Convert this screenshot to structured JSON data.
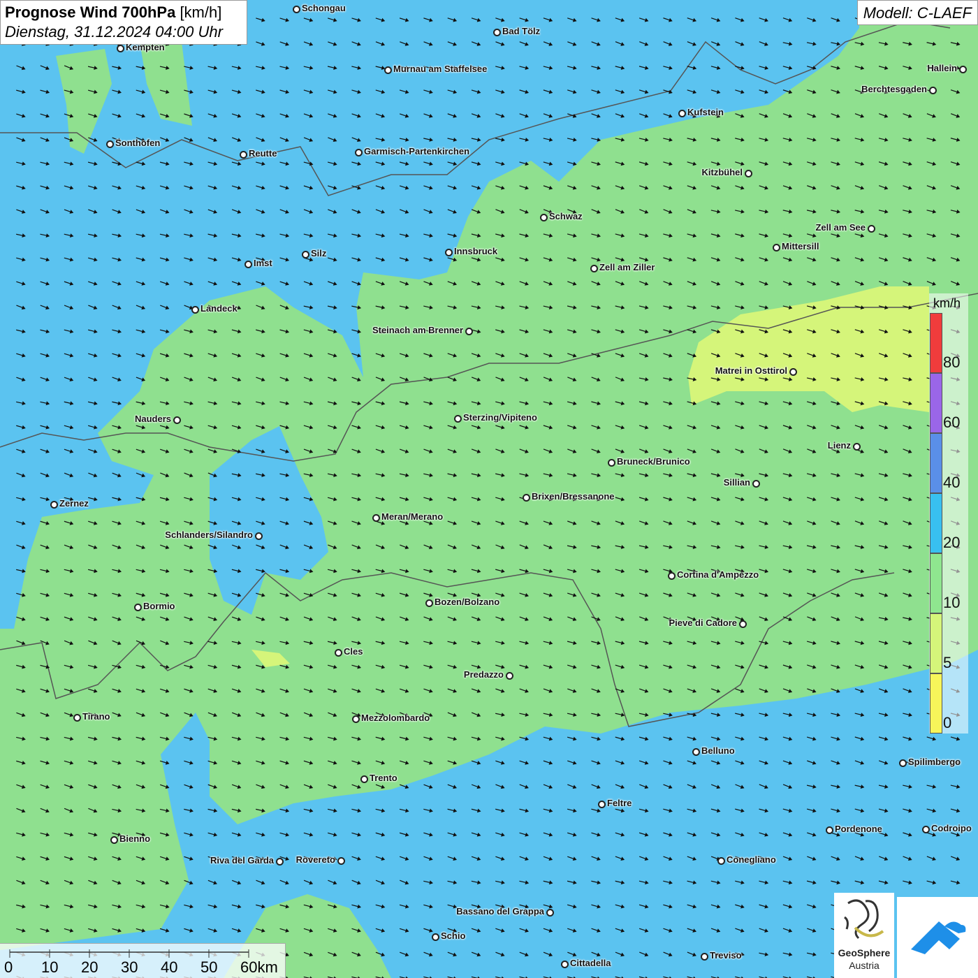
{
  "title": {
    "main": "Prognose Wind 700hPa",
    "unit": "[km/h]",
    "datetime": "Dienstag, 31.12.2024 04:00 Uhr"
  },
  "model_label": "Modell: C-LAEF",
  "colors": {
    "calm_cyan": "#5bc3f0",
    "light_green": "#8fe08f",
    "yellow_green": "#d5f57a",
    "yellow": "#f7f55a",
    "blue": "#5a8fe8",
    "purple": "#9a66e8",
    "red": "#f03c3c",
    "pale_blue": "#bfe6ff"
  },
  "legend": {
    "unit": "km/h",
    "labels": [
      "80",
      "60",
      "40",
      "20",
      "10",
      "5",
      "0"
    ],
    "bands": [
      {
        "from": 80,
        "to": 100,
        "color": "#f03c3c"
      },
      {
        "from": 60,
        "to": 80,
        "color": "#9a66e8"
      },
      {
        "from": 40,
        "to": 60,
        "color": "#5a8fe8"
      },
      {
        "from": 20,
        "to": 40,
        "color": "#38c0f0"
      },
      {
        "from": 10,
        "to": 20,
        "color": "#8fe68f"
      },
      {
        "from": 5,
        "to": 10,
        "color": "#d5f57a"
      },
      {
        "from": 0,
        "to": 5,
        "color": "#f7f55a"
      }
    ]
  },
  "scale_bar": {
    "labels": [
      "0",
      "10",
      "20",
      "30",
      "40",
      "50",
      "60km"
    ]
  },
  "cities": [
    {
      "name": "Schongau"
    },
    {
      "name": "Bad Tölz"
    },
    {
      "name": "Kempten"
    },
    {
      "name": "Murnau am Staffelsee"
    },
    {
      "name": "Hallein"
    },
    {
      "name": "Berchtesgaden"
    },
    {
      "name": "Kufstein"
    },
    {
      "name": "Sonthofen"
    },
    {
      "name": "Reutte"
    },
    {
      "name": "Garmisch-Partenkirchen"
    },
    {
      "name": "Kitzbühel"
    },
    {
      "name": "Schwaz"
    },
    {
      "name": "Zell am See"
    },
    {
      "name": "Mittersill"
    },
    {
      "name": "Innsbruck"
    },
    {
      "name": "Silz"
    },
    {
      "name": "Imst"
    },
    {
      "name": "Zell am Ziller"
    },
    {
      "name": "Landeck"
    },
    {
      "name": "Steinach am Brenner"
    },
    {
      "name": "Matrei in Osttirol"
    },
    {
      "name": "Nauders"
    },
    {
      "name": "Sterzing/Vipiteno"
    },
    {
      "name": "Lienz"
    },
    {
      "name": "Bruneck/Brunico"
    },
    {
      "name": "Sillian"
    },
    {
      "name": "Brixen/Bressanone"
    },
    {
      "name": "Zernez"
    },
    {
      "name": "Meran/Merano"
    },
    {
      "name": "Schlanders/Silandro"
    },
    {
      "name": "Cortina d'Ampezzo"
    },
    {
      "name": "Bozen/Bolzano"
    },
    {
      "name": "Bormio"
    },
    {
      "name": "Pieve di Cadore"
    },
    {
      "name": "Cles"
    },
    {
      "name": "Predazzo"
    },
    {
      "name": "Tirano"
    },
    {
      "name": "Mezzolombardo"
    },
    {
      "name": "Belluno"
    },
    {
      "name": "Spilimbergo"
    },
    {
      "name": "Trento"
    },
    {
      "name": "Feltre"
    },
    {
      "name": "Pordenone"
    },
    {
      "name": "Codroipo"
    },
    {
      "name": "Bienno"
    },
    {
      "name": "Riva del Garda"
    },
    {
      "name": "Rovereto"
    },
    {
      "name": "Conegliano"
    },
    {
      "name": "Bassano del Grappa"
    },
    {
      "name": "Schio"
    },
    {
      "name": "Treviso"
    },
    {
      "name": "Cittadella"
    }
  ],
  "logos": {
    "geosphere_name": "GeoSphere",
    "geosphere_country": "Austria"
  }
}
